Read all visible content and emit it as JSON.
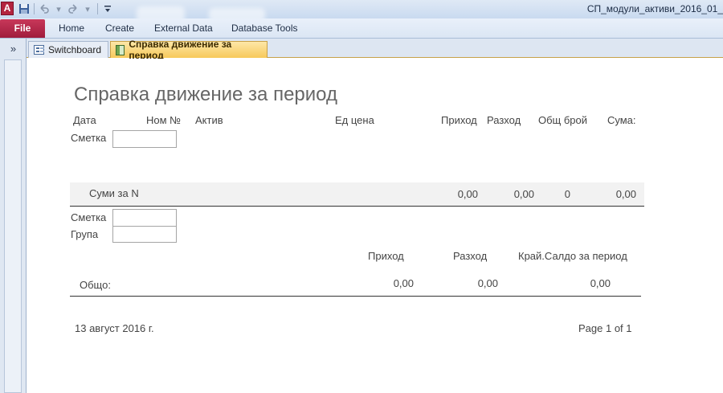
{
  "app": {
    "icon_letter": "A",
    "window_title": "СП_модули_активи_2016_01_"
  },
  "qat": {
    "icons": [
      "save-icon",
      "undo-icon",
      "redo-icon",
      "customize-icon"
    ]
  },
  "ribbon": {
    "file": "File",
    "tabs": [
      "Home",
      "Create",
      "External Data",
      "Database Tools"
    ]
  },
  "navpane": {
    "toggle": "»"
  },
  "doc_tabs": [
    {
      "label": "Switchboard",
      "icon": "form-icon",
      "active": false
    },
    {
      "label": "Справка движение за период",
      "icon": "report-icon",
      "active": true
    }
  ],
  "report": {
    "title": "Справка движение за период",
    "headers": {
      "date": "Дата",
      "num": "Ном №",
      "asset": "Актив",
      "unit_price": "Ед цена",
      "income": "Приход",
      "expense": "Разход",
      "total_count": "Общ брой",
      "sum": "Сума:"
    },
    "account_label": "Сметка",
    "group_label": "Група",
    "subtotal": {
      "label": "Суми за N",
      "income": "0,00",
      "expense": "0,00",
      "count": "0",
      "sum": "0,00"
    },
    "totals_headers": {
      "income": "Приход",
      "expense": "Разход",
      "balance": "Край.Салдо за период"
    },
    "grand_total": {
      "label": "Общо:",
      "income": "0,00",
      "expense": "0,00",
      "balance": "0,00"
    },
    "footer": {
      "date": "13 август 2016 г.",
      "page": "Page 1 of 1"
    }
  },
  "colors": {
    "file_tab": "#a01c3c",
    "active_tab": "#f7c95a",
    "ribbon_bg": "#dbe6f4"
  }
}
